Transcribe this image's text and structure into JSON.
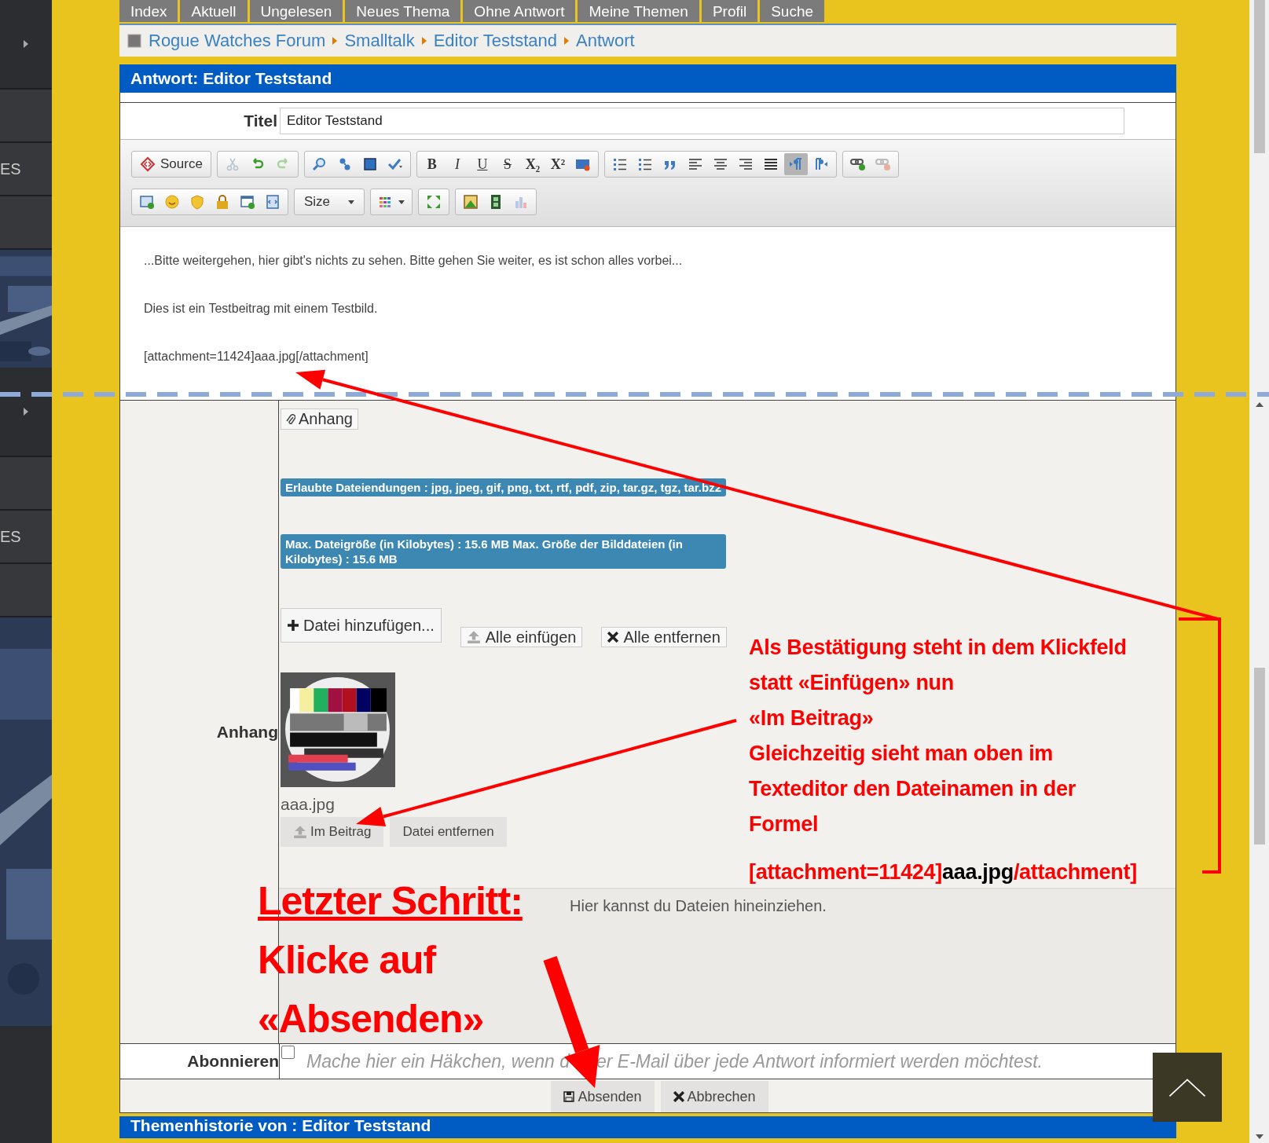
{
  "sidebar": {
    "items": [
      "ES",
      "ES"
    ]
  },
  "nav_tabs": [
    "Index",
    "Aktuell",
    "Ungelesen",
    "Neues Thema",
    "Ohne Antwort",
    "Meine Themen",
    "Profil",
    "Suche"
  ],
  "breadcrumb": [
    "Rogue Watches Forum",
    "Smalltalk",
    "Editor Teststand",
    "Antwort"
  ],
  "panel_title": "Antwort: Editor Teststand",
  "title_field": {
    "label": "Titel",
    "value": "Editor Teststand"
  },
  "toolbar": {
    "source": "Source",
    "format": [
      "B",
      "I",
      "U",
      "S",
      "X₂",
      "X²"
    ],
    "size": "Size",
    "direction": [
      {
        "selected": true
      },
      {
        "selected": false
      }
    ]
  },
  "editor": {
    "lines": [
      "...Bitte weitergehen, hier gibt's nichts zu sehen. Bitte gehen Sie weiter, es ist schon alles vorbei...",
      "Dies ist ein Testbeitrag mit einem Testbild.",
      "[attachment=11424]aaa.jpg[/attachment]"
    ]
  },
  "attachments": {
    "tab": "Anhang",
    "allowed": "Erlaubte Dateiendungen : jpg, jpeg, gif, png, txt, rtf, pdf, zip, tar.gz, tgz, tar.bz2",
    "max_size": "Max. Dateigröße (in Kilobytes) : 15.6 MB Max. Größe der Bilddateien (in Kilobytes) : 15.6 MB",
    "add": "Datei hinzufügen...",
    "insert_all": "Alle einfügen",
    "remove_all": "Alle entfernen",
    "label": "Anhang",
    "files": [
      {
        "name": "aaa.jpg",
        "insert": "Im Beitrag",
        "remove": "Datei entfernen"
      }
    ],
    "drop_hint": "Hier kannst du Dateien hineinziehen."
  },
  "subscribe": {
    "label": "Abonnieren",
    "checked": false,
    "hint": [
      "Mache hier ein Häkchen, wenn d",
      "er E-Mail über jede Antwort informiert werden möchtest."
    ]
  },
  "buttons": [
    "Absenden",
    "Abbrechen"
  ],
  "history_title": "Themenhistorie von : Editor Teststand",
  "annotations": {
    "callout": [
      "Als Bestätigung steht in dem Klickfeld",
      "statt «Einfügen» nun",
      "«Im Beitrag»",
      "Gleichzeitig sieht man oben im",
      "Texteditor den Dateinamen in der",
      "Formel"
    ],
    "formula": [
      "[attachment=11424]",
      "aaa.jpg",
      "/attachment]"
    ],
    "step": [
      "Letzter Schritt:",
      "Klicke auf",
      "«Absenden»"
    ]
  }
}
